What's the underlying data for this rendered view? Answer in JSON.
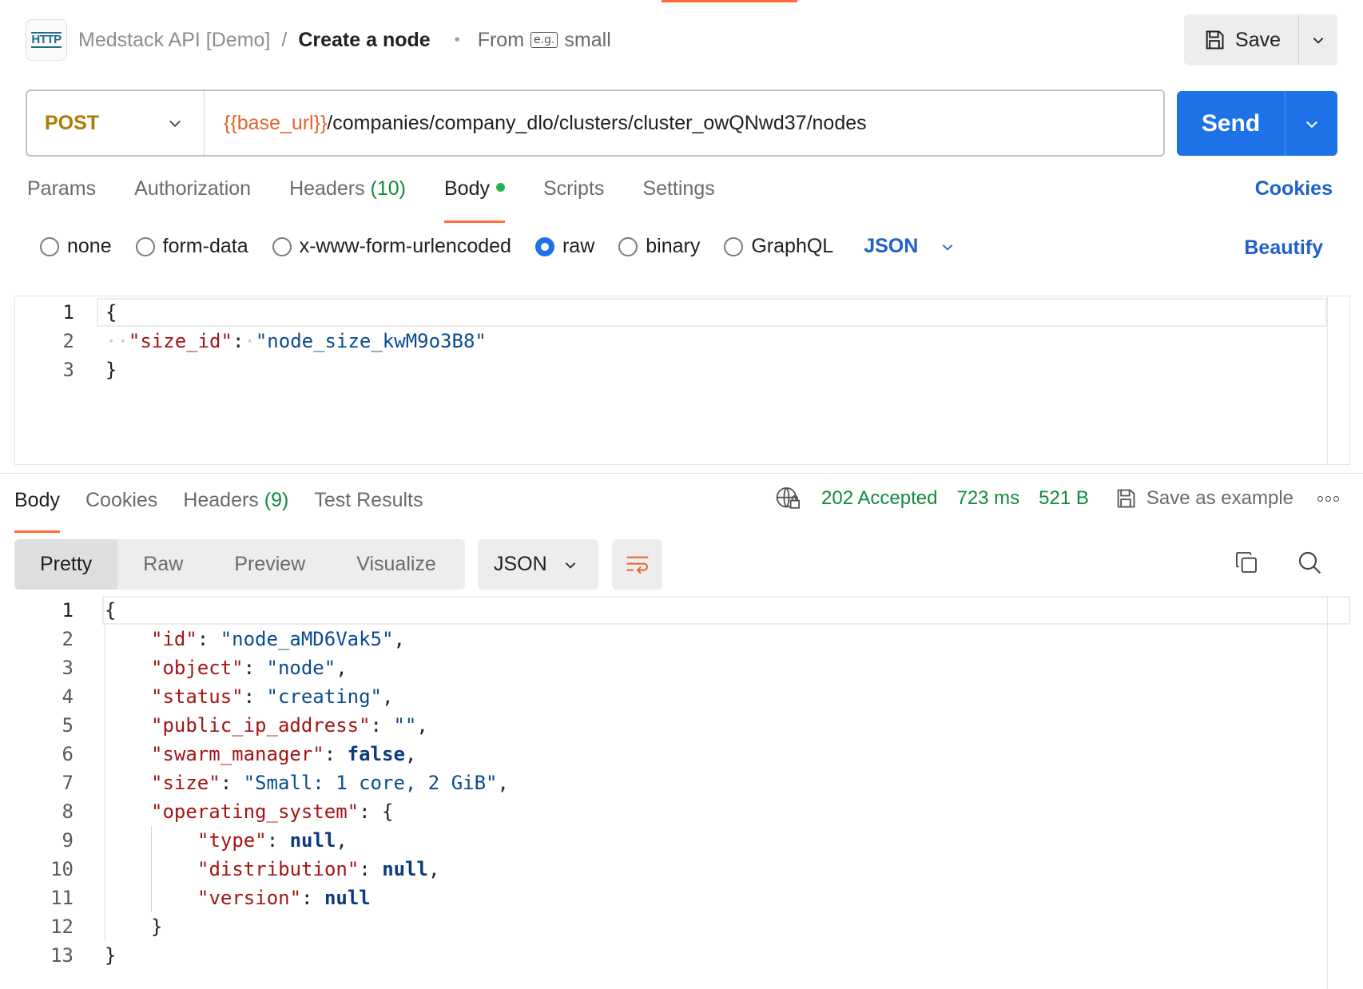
{
  "header": {
    "http_badge": "HTTP",
    "collection": "Medstack API [Demo]",
    "separator": "/",
    "request_name": "Create a node",
    "dot": "•",
    "from_label": "From",
    "example_badge": "e.g.",
    "example_name": "small",
    "save_label": "Save"
  },
  "request": {
    "method": "POST",
    "url_variable": "{{base_url}}",
    "url_path": "/companies/company_dlo/clusters/cluster_owQNwd37/nodes",
    "send_label": "Send"
  },
  "request_tabs": {
    "params": "Params",
    "authorization": "Authorization",
    "headers": "Headers",
    "headers_count": "(10)",
    "body": "Body",
    "scripts": "Scripts",
    "settings": "Settings",
    "cookies": "Cookies"
  },
  "body_types": {
    "none": "none",
    "form_data": "form-data",
    "urlencoded": "x-www-form-urlencoded",
    "raw": "raw",
    "binary": "binary",
    "graphql": "GraphQL",
    "language": "JSON",
    "selected": "raw",
    "beautify": "Beautify"
  },
  "request_body": {
    "line_numbers": [
      "1",
      "2",
      "3"
    ],
    "open_brace": "{",
    "key": "\"size_id\"",
    "colon": ":",
    "value": "\"node_size_kwM9o3B8\"",
    "close_brace": "}"
  },
  "response_tabs": {
    "body": "Body",
    "cookies": "Cookies",
    "headers": "Headers",
    "headers_count": "(9)",
    "test_results": "Test Results"
  },
  "response_meta": {
    "status": "202 Accepted",
    "time": "723 ms",
    "size": "521 B",
    "save_example": "Save as example"
  },
  "view": {
    "pretty": "Pretty",
    "raw": "Raw",
    "preview": "Preview",
    "visualize": "Visualize",
    "format": "JSON"
  },
  "response_body": {
    "line_numbers": [
      "1",
      "2",
      "3",
      "4",
      "5",
      "6",
      "7",
      "8",
      "9",
      "10",
      "11",
      "12",
      "13"
    ],
    "l1": "{",
    "id_key": "\"id\"",
    "id_val": "\"node_aMD6Vak5\"",
    "object_key": "\"object\"",
    "object_val": "\"node\"",
    "status_key": "\"status\"",
    "status_val": "\"creating\"",
    "ip_key": "\"public_ip_address\"",
    "ip_val": "\"\"",
    "swarm_key": "\"swarm_manager\"",
    "swarm_val": "false",
    "size_key": "\"size\"",
    "size_val": "\"Small: 1 core, 2 GiB\"",
    "os_key": "\"operating_system\"",
    "os_open": "{",
    "type_key": "\"type\"",
    "type_val": "null",
    "dist_key": "\"distribution\"",
    "dist_val": "null",
    "ver_key": "\"version\"",
    "ver_val": "null",
    "os_close": "}",
    "l13": "}"
  },
  "colors": {
    "accent": "#ff6c37",
    "send": "#1d72e8",
    "method": "#ad7a03",
    "status_green": "#0f8a3c"
  }
}
